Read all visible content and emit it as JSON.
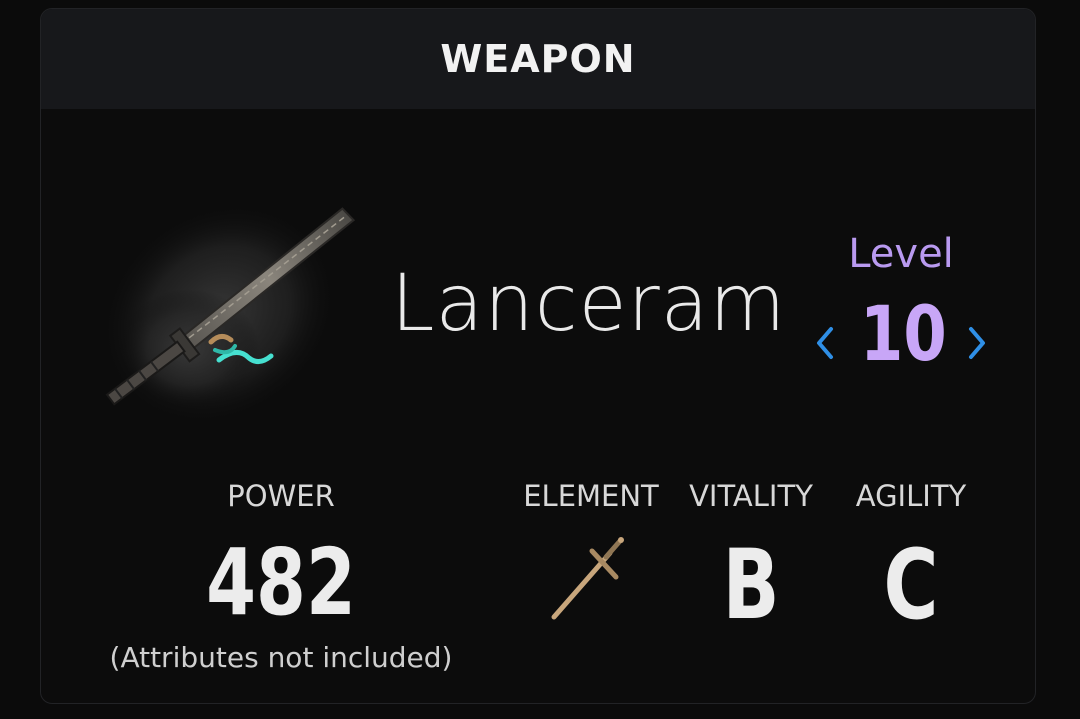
{
  "header": {
    "title": "WEAPON"
  },
  "weapon": {
    "name": "Lanceram",
    "image_icon": "greatsword-icon"
  },
  "level": {
    "label": "Level",
    "value": "10",
    "prev_icon": "chevron-left-icon",
    "next_icon": "chevron-right-icon",
    "arrow_color": "#2f8fe6",
    "text_color": "#c8a6f7"
  },
  "stats": {
    "power": {
      "label": "POWER",
      "value": "482",
      "note": "(Attributes not included)"
    },
    "element": {
      "label": "ELEMENT",
      "icon": "sword-element-icon"
    },
    "vitality": {
      "label": "VITALITY",
      "value": "B"
    },
    "agility": {
      "label": "AGILITY",
      "value": "C"
    }
  }
}
